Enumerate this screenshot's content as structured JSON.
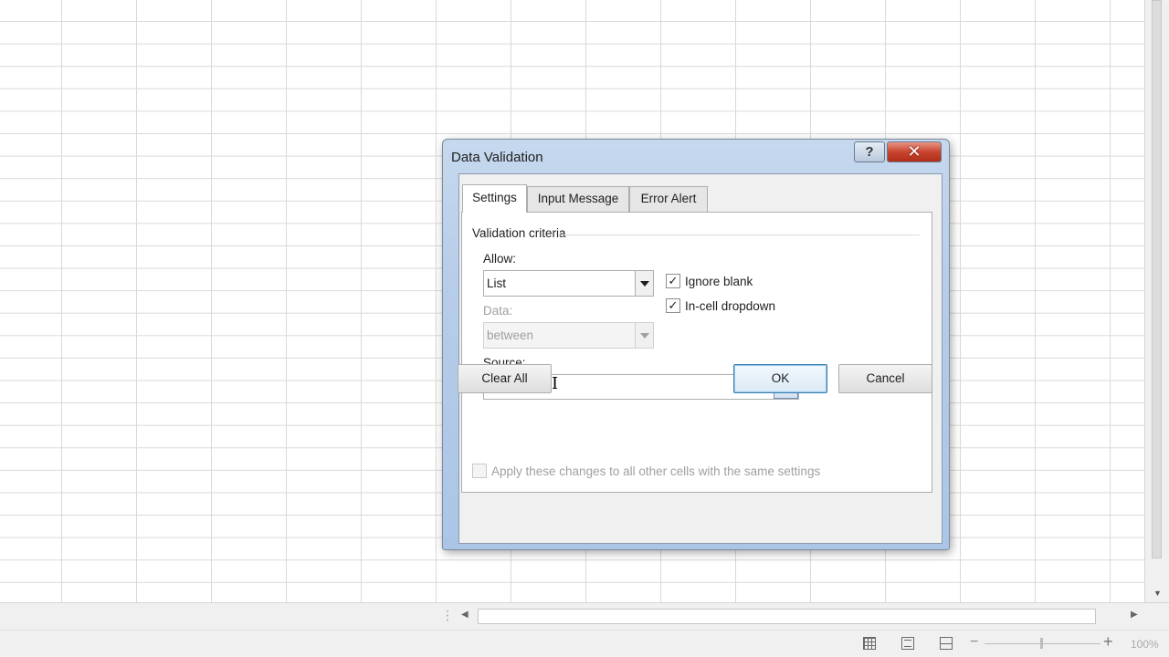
{
  "dialog": {
    "title": "Data Validation",
    "help_label": "?",
    "close_label": "✕"
  },
  "tabs": [
    {
      "label": "Settings",
      "selected": true
    },
    {
      "label": "Input Message",
      "selected": false
    },
    {
      "label": "Error Alert",
      "selected": false
    }
  ],
  "settings": {
    "group_label": "Validation criteria",
    "allow_label": "Allow:",
    "allow_value": "List",
    "data_label": "Data:",
    "data_value": "between",
    "source_label": "Source:",
    "source_value": "=",
    "ignore_blank_label": "Ignore blank",
    "ignore_blank_checked": true,
    "in_cell_dropdown_label": "In-cell dropdown",
    "in_cell_dropdown_checked": true,
    "apply_all_label": "Apply these changes to all other cells with the same settings",
    "apply_all_checked": false
  },
  "buttons": {
    "clear_all": "Clear All",
    "ok": "OK",
    "cancel": "Cancel"
  },
  "status": {
    "zoom": "100%"
  },
  "icons": {
    "check": "✓"
  },
  "colors": {
    "dialog_frame": "#aac5e6",
    "close_button": "#c8452f",
    "ok_border": "#3c7fb1"
  }
}
